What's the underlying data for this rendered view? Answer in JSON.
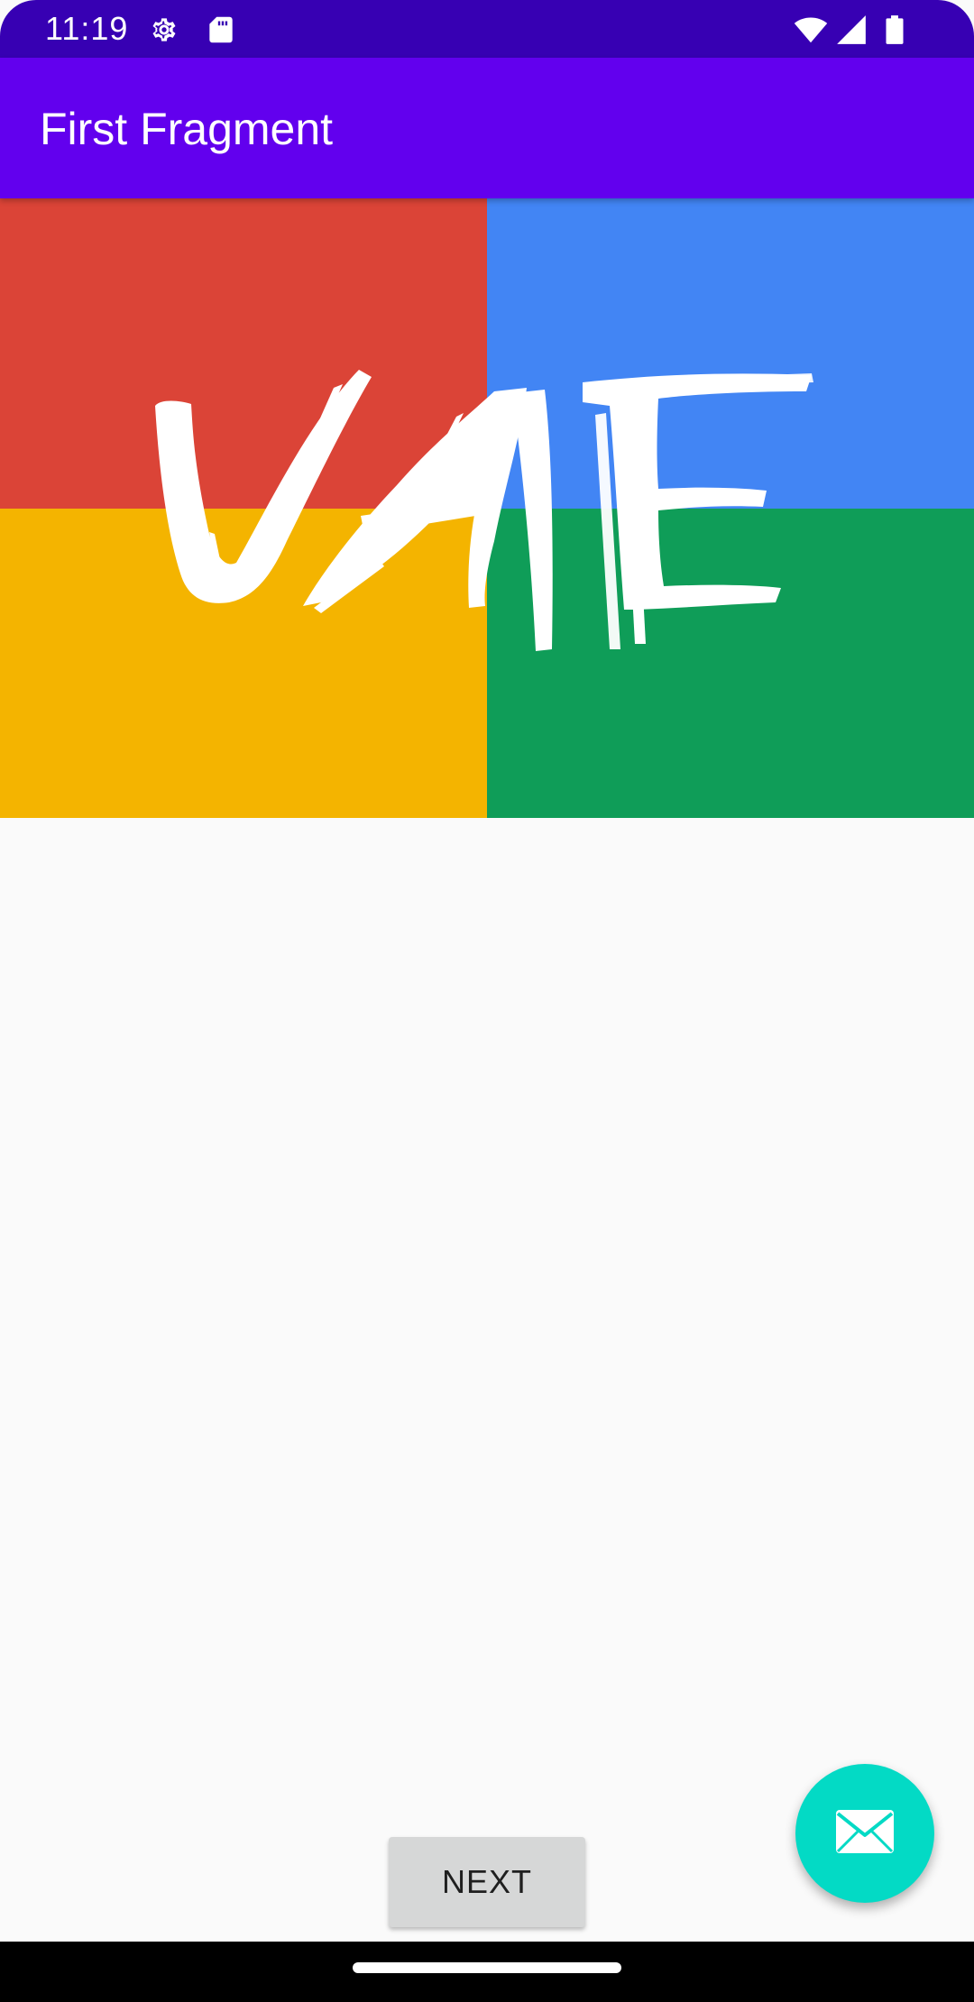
{
  "status_bar": {
    "time": "11:19",
    "icons": [
      "settings-icon",
      "sd-card-icon",
      "wifi-icon",
      "cell-signal-icon",
      "battery-icon"
    ]
  },
  "app_bar": {
    "title": "First Fragment"
  },
  "logo": {
    "text": "VAE",
    "colors": {
      "top_left": "#db4437",
      "top_right": "#4285f4",
      "bottom_left": "#f4b400",
      "bottom_right": "#0f9d58"
    }
  },
  "buttons": {
    "next_label": "NEXT"
  },
  "fab": {
    "icon": "mail-icon"
  },
  "colors": {
    "status_bar": "#3700b3",
    "app_bar": "#6200ee",
    "fab": "#03dac5",
    "background": "#fafafa"
  }
}
